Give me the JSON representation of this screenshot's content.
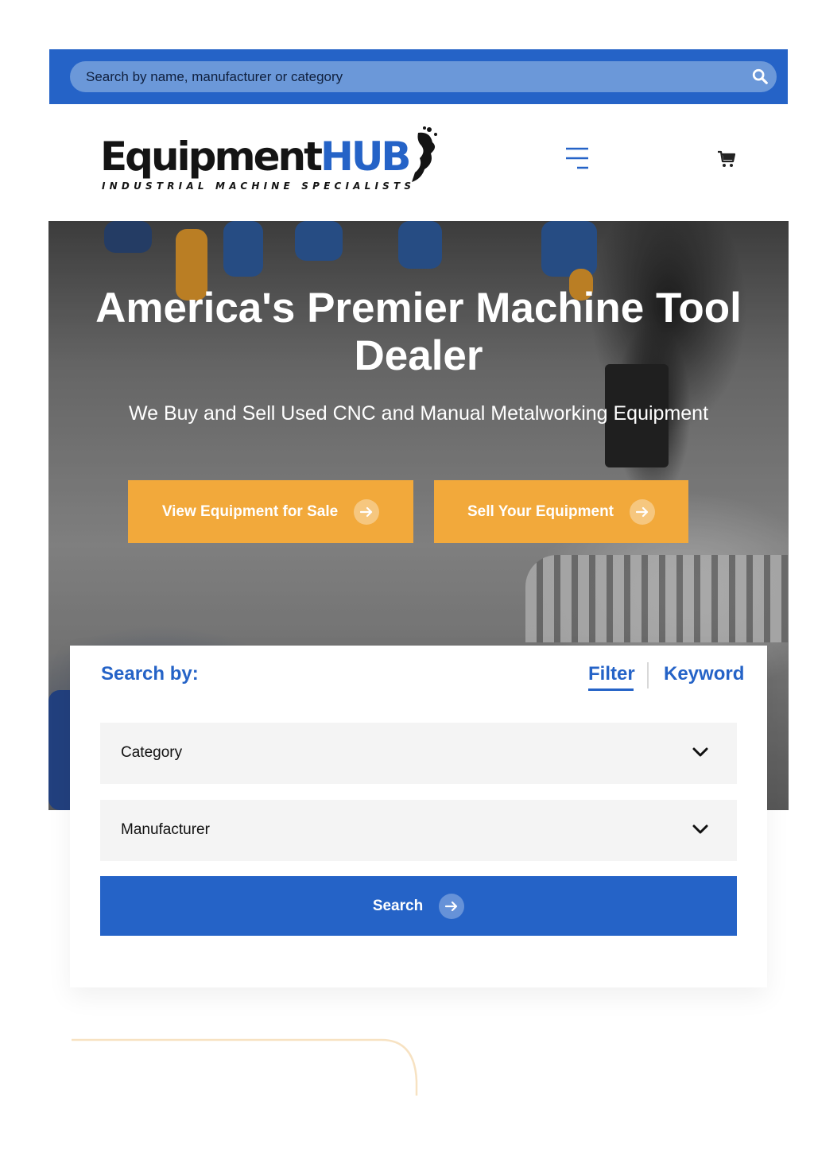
{
  "topbar": {
    "search_placeholder": "Search by name, manufacturer or category",
    "search_icon": "search-icon"
  },
  "header": {
    "logo": {
      "main_black": "Equipment",
      "main_blue": "HUB",
      "tagline": "INDUSTRIAL MACHINE SPECIALISTS"
    },
    "menu_icon": "hamburger-menu-icon",
    "cart_icon": "cart-icon"
  },
  "hero": {
    "title": "America's Premier Machine Tool Dealer",
    "subtitle": "We Buy and Sell Used CNC and Manual Metalworking Equipment",
    "buttons": [
      {
        "label": "View Equipment for Sale",
        "icon": "arrow-right-icon"
      },
      {
        "label": "Sell Your Equipment",
        "icon": "arrow-right-icon"
      }
    ]
  },
  "search_card": {
    "title": "Search by:",
    "tabs": [
      {
        "label": "Filter",
        "active": true
      },
      {
        "label": "Keyword",
        "active": false
      }
    ],
    "selects": [
      {
        "value": "Category",
        "icon": "chevron-down-icon"
      },
      {
        "value": "Manufacturer",
        "icon": "chevron-down-icon"
      }
    ],
    "search_button": {
      "label": "Search",
      "icon": "arrow-right-icon"
    }
  },
  "colors": {
    "brand_blue": "#2563c7",
    "accent_orange": "#f2a93b",
    "select_bg": "#f4f4f4"
  }
}
